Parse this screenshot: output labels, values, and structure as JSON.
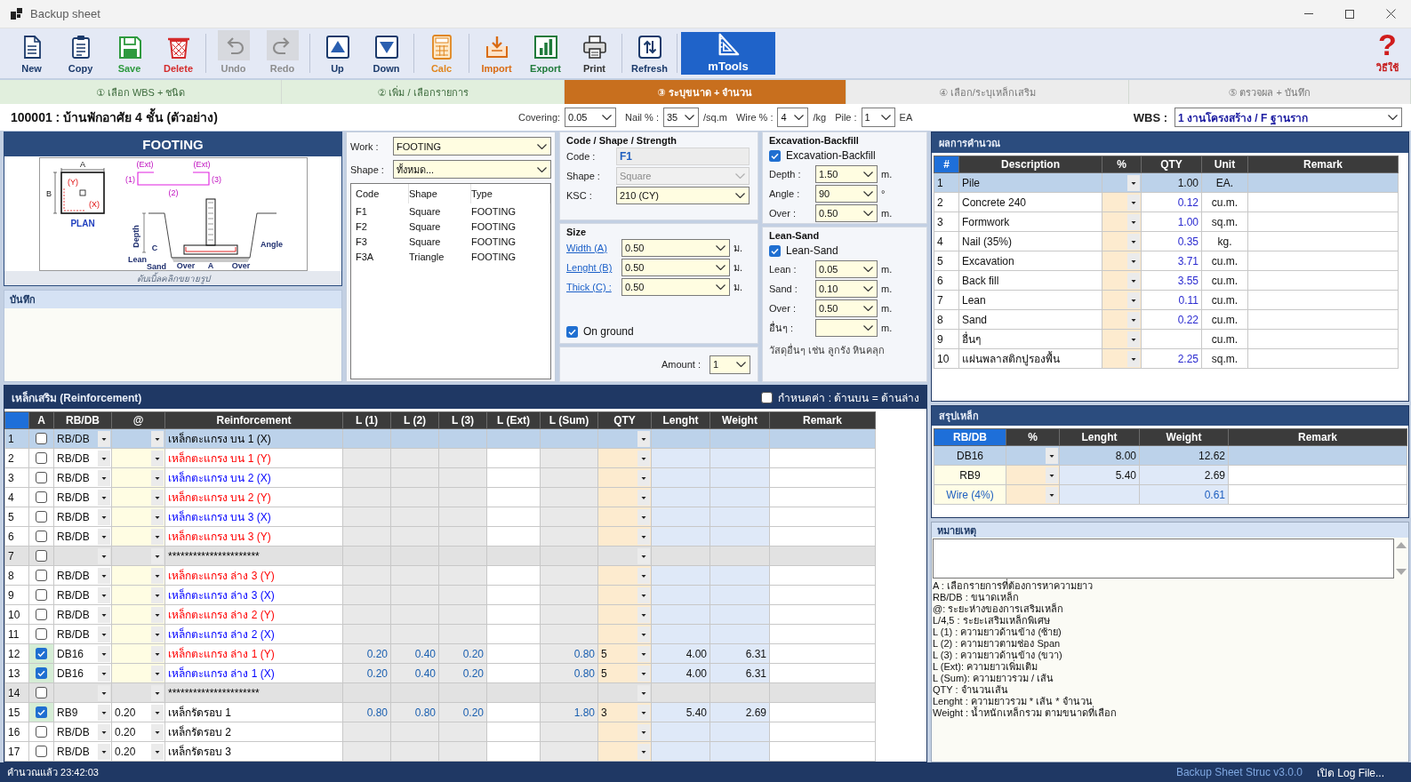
{
  "window": {
    "title": "Backup sheet"
  },
  "toolbar": {
    "groups": [
      [
        {
          "kind": "new",
          "label": "New",
          "disabled": false,
          "highlighted": false
        },
        {
          "kind": "copy",
          "label": "Copy",
          "disabled": false,
          "highlighted": false
        },
        {
          "kind": "save",
          "label": "Save",
          "disabled": false,
          "highlighted": false
        },
        {
          "kind": "delete",
          "label": "Delete",
          "disabled": false,
          "highlighted": false
        }
      ],
      [
        {
          "kind": "undo",
          "label": "Undo",
          "disabled": true,
          "highlighted": false
        },
        {
          "kind": "redo",
          "label": "Redo",
          "disabled": true,
          "highlighted": false
        }
      ],
      [
        {
          "kind": "up",
          "label": "Up",
          "disabled": false,
          "highlighted": false
        },
        {
          "kind": "down",
          "label": "Down",
          "disabled": false,
          "highlighted": false
        }
      ],
      [
        {
          "kind": "calc",
          "label": "Calc",
          "disabled": false,
          "highlighted": false
        }
      ],
      [
        {
          "kind": "import",
          "label": "Import",
          "disabled": false,
          "highlighted": false
        },
        {
          "kind": "export",
          "label": "Export",
          "disabled": false,
          "highlighted": false
        },
        {
          "kind": "print",
          "label": "Print",
          "disabled": false,
          "highlighted": false
        }
      ],
      [
        {
          "kind": "refresh",
          "label": "Refresh",
          "disabled": false,
          "highlighted": false
        }
      ],
      [
        {
          "kind": "tools",
          "label": "mTools",
          "disabled": false,
          "highlighted": true
        }
      ]
    ],
    "help": {
      "glyph": "?",
      "label": "วิธีใช้"
    }
  },
  "steps": [
    {
      "label": "① เลือก WBS + ชนิด",
      "completed": true,
      "selected": false
    },
    {
      "label": "② เพิ่ม / เลือกรายการ",
      "completed": true,
      "selected": false
    },
    {
      "label": "③ ระบุขนาด + จำนวน",
      "completed": false,
      "selected": true
    },
    {
      "label": "④ เลือก/ระบุเหล็กเสริม",
      "completed": false,
      "selected": false
    },
    {
      "label": "⑤ ตรวจผล + บันทึก",
      "completed": false,
      "selected": false
    }
  ],
  "project": {
    "title": "100001 : บ้านพักอาศัย 4 ชั้น (ตัวอย่าง)",
    "fields": [
      {
        "label": "Covering:",
        "value": "0.05"
      },
      {
        "label": "Nail % :",
        "value": "35",
        "unit": "/sq.m"
      },
      {
        "label": "Wire % :",
        "value": "4",
        "unit": "/kg"
      },
      {
        "label": "Pile :",
        "value": "1",
        "unit": "EA"
      }
    ],
    "wbs": {
      "label": "WBS :",
      "value": "1 งานโครงสร้าง / F ฐานราก"
    }
  },
  "footing": {
    "title": "FOOTING",
    "diagram": {
      "plan_title": "PLAN",
      "plan_labels": [
        "A",
        "B",
        "(Y)",
        "(X)"
      ],
      "bar_labels": [
        "(Ext)",
        "(Ext)",
        "(1)",
        "(2)",
        "(3)"
      ],
      "section_labels": [
        "Depth",
        "C",
        "Lean",
        "Sand",
        "Over",
        "A",
        "Over",
        "Angle"
      ]
    },
    "caption": "ดับเบิ้ลคลิกขยายรูป",
    "notes_title": "บันทึก"
  },
  "work_panel": {
    "work": {
      "label": "Work :",
      "value": "FOOTING"
    },
    "shape": {
      "label": "Shape :",
      "value": "ทั้งหมด..."
    },
    "list": {
      "columns": [
        "Code",
        "Shape",
        "Type"
      ],
      "rows": [
        [
          "F1",
          "Square",
          "FOOTING"
        ],
        [
          "F2",
          "Square",
          "FOOTING"
        ],
        [
          "F3",
          "Square",
          "FOOTING"
        ],
        [
          "F3A",
          "Triangle",
          "FOOTING"
        ]
      ]
    }
  },
  "code_group": {
    "title": "Code / Shape / Strength",
    "fields": [
      {
        "kind": "readonly",
        "label": "Code :",
        "value": "F1",
        "disabled": false
      },
      {
        "kind": "select",
        "label": "Shape :",
        "value": "Square",
        "disabled": true
      },
      {
        "kind": "select",
        "label": "KSC :",
        "value": "210 (CY)",
        "disabled": false
      }
    ]
  },
  "size_group": {
    "title": "Size",
    "fields": [
      {
        "label": "Width (A)",
        "value": "0.50",
        "unit": "ม."
      },
      {
        "label": "Lenght (B)",
        "value": "0.50",
        "unit": "ม."
      },
      {
        "label": "Thick (C) :",
        "value": "0.50",
        "unit": "ม."
      }
    ],
    "on_ground": {
      "label": "On ground",
      "checked": true
    }
  },
  "amount": {
    "label": "Amount :",
    "value": "1"
  },
  "excavation": {
    "title": "Excavation-Backfill",
    "toggle": {
      "label": "Excavation-Backfill",
      "checked": true
    },
    "fields": [
      {
        "label": "Depth :",
        "value": "1.50",
        "unit": "m."
      },
      {
        "label": "Angle :",
        "value": "90",
        "unit": "°"
      },
      {
        "label": "Over :",
        "value": "0.50",
        "unit": "m."
      }
    ]
  },
  "lean_sand": {
    "title": "Lean-Sand",
    "toggle": {
      "label": "Lean-Sand",
      "checked": true
    },
    "fields": [
      {
        "label": "Lean :",
        "value": "0.05",
        "unit": "m."
      },
      {
        "label": "Sand :",
        "value": "0.10",
        "unit": "m."
      },
      {
        "label": "Over :",
        "value": "0.50",
        "unit": "m."
      },
      {
        "label": "อื่นๆ :",
        "unit": "m."
      }
    ],
    "note": "วัสดุอื่นๆ เช่น ลูกรัง หินคลุก"
  },
  "results": {
    "title": "ผลการคำนวณ",
    "columns": [
      "#",
      "Description",
      "%",
      "QTY",
      "Unit",
      "Remark"
    ],
    "rows": [
      {
        "no": "1",
        "description": "Pile",
        "qty": "1.00",
        "unit": "EA.",
        "selected": true
      },
      {
        "no": "2",
        "description": "Concrete 240",
        "qty": "0.12",
        "unit": "cu.m.",
        "selected": false
      },
      {
        "no": "3",
        "description": "Formwork",
        "qty": "1.00",
        "unit": "sq.m.",
        "selected": false
      },
      {
        "no": "4",
        "description": "Nail (35%)",
        "qty": "0.35",
        "unit": "kg.",
        "selected": false
      },
      {
        "no": "5",
        "description": "Excavation",
        "qty": "3.71",
        "unit": "cu.m.",
        "selected": false
      },
      {
        "no": "6",
        "description": "Back fill",
        "qty": "3.55",
        "unit": "cu.m.",
        "selected": false
      },
      {
        "no": "7",
        "description": "Lean",
        "qty": "0.11",
        "unit": "cu.m.",
        "selected": false
      },
      {
        "no": "8",
        "description": "Sand",
        "qty": "0.22",
        "unit": "cu.m.",
        "selected": false
      },
      {
        "no": "9",
        "description": "อื่นๆ",
        "unit": "cu.m.",
        "selected": false
      },
      {
        "no": "10",
        "description": "แผ่นพลาสติกปูรองพื้น",
        "qty": "2.25",
        "unit": "sq.m.",
        "selected": false
      }
    ]
  },
  "steel_summary": {
    "title": "สรุปเหล็ก",
    "columns": [
      "RB/DB",
      "%",
      "Lenght",
      "Weight",
      "Remark"
    ],
    "rows": [
      {
        "kind": "bar",
        "size": "DB16",
        "length": "8.00",
        "weight": "12.62",
        "selected": true
      },
      {
        "kind": "bar",
        "size": "RB9",
        "length": "5.40",
        "weight": "2.69",
        "selected": false
      },
      {
        "kind": "wire",
        "size": "Wire (4%)",
        "weight": "0.61",
        "selected": false
      }
    ]
  },
  "remarks": {
    "title": "หมายเหตุ",
    "legend": [
      "A : เลือกรายการที่ต้องการหาความยาว",
      "RB/DB : ขนาดเหล็ก",
      "@: ระยะห่างของการเสริมเหล็ก",
      "L/4,5 : ระยะเสริมเหล็กพิเศษ",
      "L (1) : ความยาวด้านข้าง (ซ้าย)",
      "L (2) : ความยาวตามช่อง Span",
      "L (3) : ความยาวด้านข้าง (ขวา)",
      "L (Ext): ความยาวเพิ่มเติม",
      "L (Sum): ความยาวรวม / เส้น",
      "QTY : จำนวนเส้น",
      "Lenght : ความยาวรวม * เส้น * จำนวน",
      "Weight : น้ำหนักเหล็กรวม ตามขนาดที่เลือก"
    ]
  },
  "reinforcement": {
    "title": "เหล็กเสริม (Reinforcement)",
    "same_top_bottom": {
      "label": "กำหนดค่า : ด้านบน = ด้านล่าง",
      "checked": false
    },
    "columns": [
      "A",
      "RB/DB",
      "@",
      "Reinforcement",
      "L (1)",
      "L (2)",
      "L (3)",
      "L (Ext)",
      "L (Sum)",
      "QTY",
      "Lenght",
      "Weight",
      "Remark"
    ],
    "rows": [
      {
        "no": "1",
        "kind": "bar",
        "checked": false,
        "selected": true,
        "size": "RB/DB",
        "name": "เหล็กตะแกรง บน 1 (X)",
        "color": "#000000"
      },
      {
        "no": "2",
        "kind": "bar",
        "checked": false,
        "selected": false,
        "size": "RB/DB",
        "name": "เหล็กตะแกรง บน 1 (Y)",
        "color": "#ff0000"
      },
      {
        "no": "3",
        "kind": "bar",
        "checked": false,
        "selected": false,
        "size": "RB/DB",
        "name": "เหล็กตะแกรง บน 2 (X)",
        "color": "#0000ff"
      },
      {
        "no": "4",
        "kind": "bar",
        "checked": false,
        "selected": false,
        "size": "RB/DB",
        "name": "เหล็กตะแกรง บน 2 (Y)",
        "color": "#ff0000"
      },
      {
        "no": "5",
        "kind": "bar",
        "checked": false,
        "selected": false,
        "size": "RB/DB",
        "name": "เหล็กตะแกรง บน 3 (X)",
        "color": "#0000ff"
      },
      {
        "no": "6",
        "kind": "bar",
        "checked": false,
        "selected": false,
        "size": "RB/DB",
        "name": "เหล็กตะแกรง บน 3 (Y)",
        "color": "#ff0000"
      },
      {
        "no": "7",
        "kind": "separator",
        "checked": false,
        "selected": false,
        "name": "**********************",
        "color": "#000000"
      },
      {
        "no": "8",
        "kind": "bar",
        "checked": false,
        "selected": false,
        "size": "RB/DB",
        "name": "เหล็กตะแกรง ล่าง 3 (Y)",
        "color": "#ff0000"
      },
      {
        "no": "9",
        "kind": "bar",
        "checked": false,
        "selected": false,
        "size": "RB/DB",
        "name": "เหล็กตะแกรง ล่าง 3 (X)",
        "color": "#0000ff"
      },
      {
        "no": "10",
        "kind": "bar",
        "checked": false,
        "selected": false,
        "size": "RB/DB",
        "name": "เหล็กตะแกรง ล่าง 2 (Y)",
        "color": "#ff0000"
      },
      {
        "no": "11",
        "kind": "bar",
        "checked": false,
        "selected": false,
        "size": "RB/DB",
        "name": "เหล็กตะแกรง ล่าง 2 (X)",
        "color": "#0000ff"
      },
      {
        "no": "12",
        "kind": "bar",
        "checked": true,
        "selected": false,
        "size": "DB16",
        "name": "เหล็กตะแกรง ล่าง 1 (Y)",
        "color": "#ff0000",
        "l1": "0.20",
        "l2": "0.40",
        "l3": "0.20",
        "l_sum": "0.80",
        "qty": "5",
        "length": "4.00",
        "weight": "6.31"
      },
      {
        "no": "13",
        "kind": "bar",
        "checked": true,
        "selected": false,
        "size": "DB16",
        "name": "เหล็กตะแกรง ล่าง 1 (X)",
        "color": "#0000ff",
        "l1": "0.20",
        "l2": "0.40",
        "l3": "0.20",
        "l_sum": "0.80",
        "qty": "5",
        "length": "4.00",
        "weight": "6.31"
      },
      {
        "no": "14",
        "kind": "separator",
        "checked": false,
        "selected": false,
        "name": "**********************",
        "color": "#000000"
      },
      {
        "no": "15",
        "kind": "bar",
        "checked": true,
        "selected": false,
        "size": "RB9",
        "spacing": "0.20",
        "name": "เหล็กรัดรอบ 1",
        "color": "#000000",
        "l1": "0.80",
        "l2": "0.80",
        "l3": "0.20",
        "l_sum": "1.80",
        "qty": "3",
        "length": "5.40",
        "weight": "2.69"
      },
      {
        "no": "16",
        "kind": "bar",
        "checked": false,
        "selected": false,
        "size": "RB/DB",
        "spacing": "0.20",
        "name": "เหล็กรัดรอบ 2",
        "color": "#000000"
      },
      {
        "no": "17",
        "kind": "bar",
        "checked": false,
        "selected": false,
        "size": "RB/DB",
        "spacing": "0.20",
        "name": "เหล็กรัดรอบ 3",
        "color": "#000000"
      }
    ]
  },
  "status_bar": {
    "message": "คำนวณแล้ว 23:42:03",
    "version": "Backup Sheet Struc v3.0.0",
    "log_link": "เปิด Log File..."
  }
}
